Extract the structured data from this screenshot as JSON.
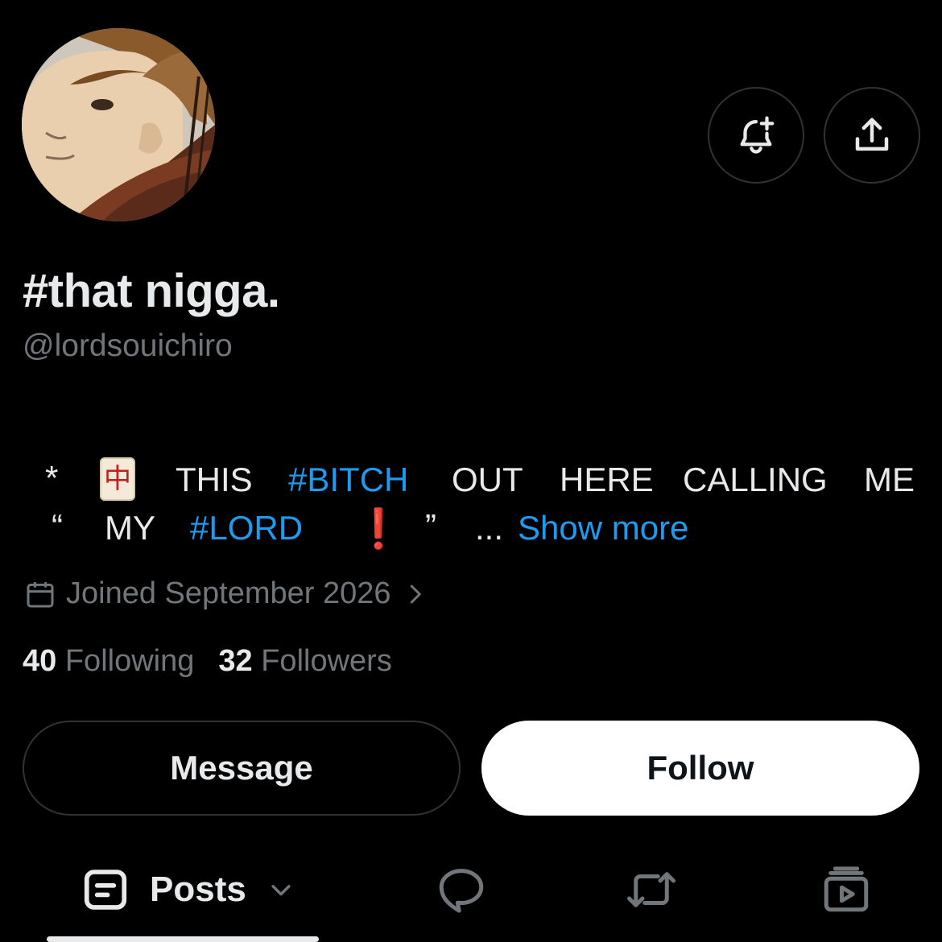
{
  "profile": {
    "display_name": "#that nigga.",
    "handle": "@lordsouichiro",
    "bio": {
      "asterisk": "*",
      "tile": "中",
      "w_this": "THIS",
      "w_bitch": "#BITCH",
      "w_out": "OUT",
      "w_here": "HERE",
      "w_calling": "CALLING",
      "w_me": "ME",
      "open_quote": "“",
      "w_my": "MY",
      "w_lord": "#LORD",
      "exclaim": "❗",
      "close_quote": "”",
      "ellipsis": "...",
      "show_more": "Show more"
    },
    "joined": "Joined September 2026",
    "stats": {
      "following_count": "40",
      "following_label": "Following",
      "followers_count": "32",
      "followers_label": "Followers"
    }
  },
  "actions": {
    "message_label": "Message",
    "follow_label": "Follow"
  },
  "tabs": {
    "posts_label": "Posts",
    "icons": [
      "posts-icon",
      "replies-icon",
      "reposts-icon",
      "media-icon"
    ]
  },
  "colors": {
    "background": "#000000",
    "text_primary": "#e7e9ea",
    "text_secondary": "#71767b",
    "link": "#1d9bf0",
    "border": "#2f3336",
    "follow_bg": "#ffffff"
  }
}
